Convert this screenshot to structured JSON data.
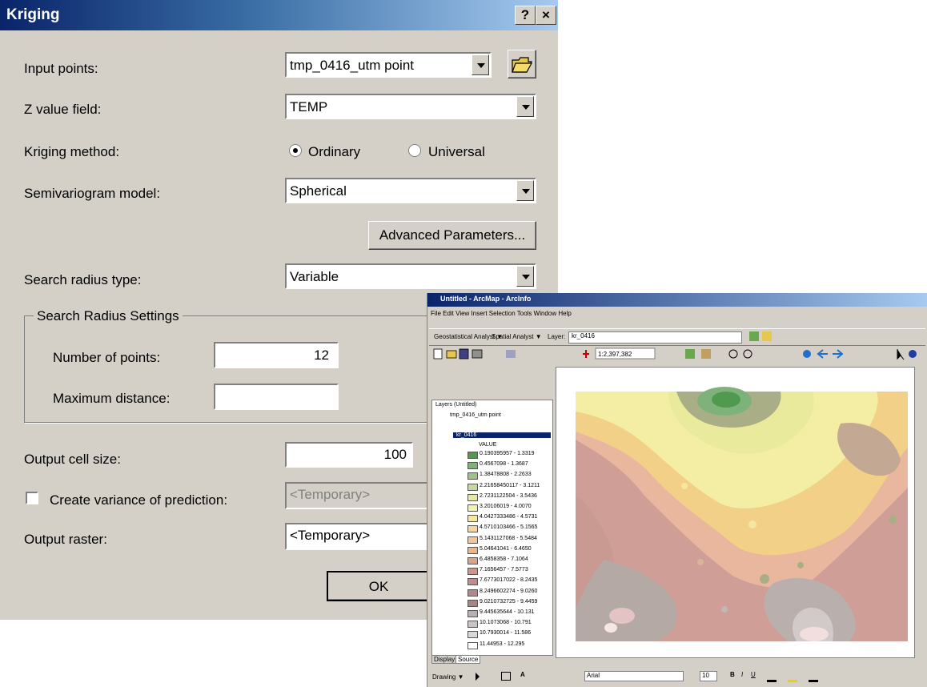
{
  "dialog": {
    "title": "Kriging",
    "help_button": "?",
    "close_button": "×",
    "input_points_label": "Input points:",
    "input_points_value": "tmp_0416_utm point",
    "z_field_label": "Z value field:",
    "z_field_value": "TEMP",
    "method_label": "Kriging method:",
    "method_ordinary": "Ordinary",
    "method_universal": "Universal",
    "method_selected": "Ordinary",
    "model_label": "Semivariogram model:",
    "model_value": "Spherical",
    "advanced_button": "Advanced Parameters...",
    "radius_type_label": "Search radius type:",
    "radius_type_value": "Variable",
    "radius_group_label": "Search Radius Settings",
    "num_points_label": "Number of points:",
    "num_points_value": "12",
    "max_distance_label": "Maximum distance:",
    "max_distance_value": "",
    "cell_size_label": "Output cell size:",
    "cell_size_value": "100",
    "variance_label": "Create variance of prediction:",
    "variance_checked": false,
    "variance_value": "<Temporary>",
    "output_raster_label": "Output raster:",
    "output_raster_value": "<Temporary>",
    "ok_button": "OK"
  },
  "arcmap": {
    "title": "Untitled - ArcMap - ArcInfo",
    "menu": "File  Edit  View  Insert  Selection  Tools  Window  Help",
    "geostat_label": "Geostatistical Analyst ▼",
    "spatial_label": "Spatial Analyst ▼",
    "layer_label": "Layer:",
    "layer_value": "kr_0416",
    "scale_value": "1:2,397,382",
    "toc_root": "Layers (Untitled)",
    "toc_points": "tmp_0416_utm point",
    "toc_raster": "kr_0416",
    "toc_value": "VALUE",
    "legend": [
      {
        "label": "0.190395957 - 1.3319",
        "color": "#4f9a4f"
      },
      {
        "label": "0.4567098 - 1.3687",
        "color": "#7fb27a"
      },
      {
        "label": "1.38478808 - 2.2633",
        "color": "#9fc28a"
      },
      {
        "label": "2.21658450117 - 3.1211",
        "color": "#c6d7a0"
      },
      {
        "label": "2.7231122504 - 3.5436",
        "color": "#e6e8a8"
      },
      {
        "label": "3.20106019 - 4.0070",
        "color": "#f4f2a8"
      },
      {
        "label": "4.0427333486 - 4.5731",
        "color": "#f7e6a3"
      },
      {
        "label": "4.5710103466 - 5.1565",
        "color": "#f6d69a"
      },
      {
        "label": "5.1431127068 - 5.5484",
        "color": "#f3c793"
      },
      {
        "label": "5.04641041 - 6.4650",
        "color": "#e8b88c"
      },
      {
        "label": "6.4858358 - 7.1064",
        "color": "#d9a58a"
      },
      {
        "label": "7.1656457 - 7.5773",
        "color": "#cc978a"
      },
      {
        "label": "7.6773017022 - 8.2435",
        "color": "#c08c8c"
      },
      {
        "label": "8.2496602274 - 9.0260",
        "color": "#b38787"
      },
      {
        "label": "9.0210732725 - 9.4459",
        "color": "#a78686"
      },
      {
        "label": "9.445635644 - 10.131",
        "color": "#b8b0b0"
      },
      {
        "label": "10.1073068 - 10.791",
        "color": "#c9c4c4"
      },
      {
        "label": "10.7930014 - 11.586",
        "color": "#dad7d7"
      },
      {
        "label": "11.44953 - 12.295",
        "color": "#ffffff"
      }
    ],
    "tabs": [
      "Display",
      "Source"
    ],
    "drawing_label": "Drawing ▼",
    "font_value": "Arial",
    "font_size": "10"
  }
}
